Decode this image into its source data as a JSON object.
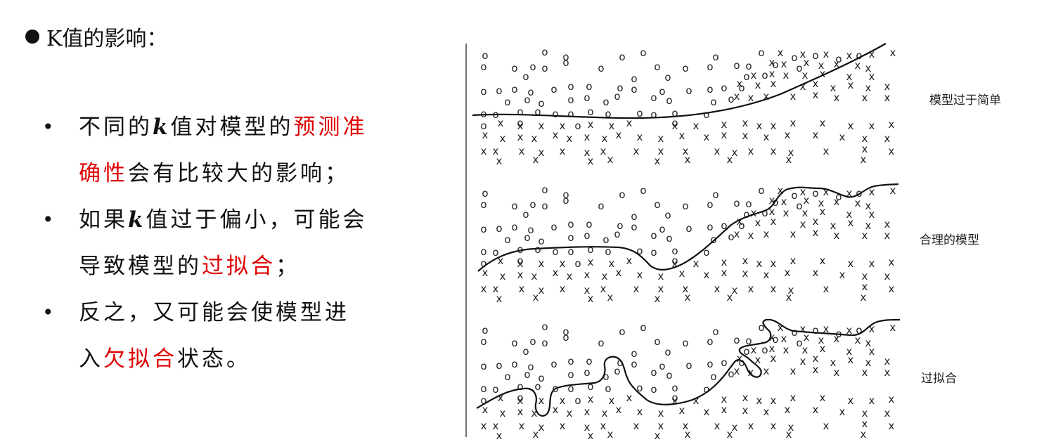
{
  "heading": "K值的影响：",
  "bullets": [
    {
      "mark": "•",
      "line1": {
        "a": "不同的",
        "k": "k",
        "b": "值对模型的",
        "red": "预测准"
      },
      "line2": {
        "red": "确性",
        "b": "会有比较大的影响；"
      }
    },
    {
      "mark": "•",
      "line1": {
        "a": "如果",
        "k": "k",
        "b": "值过于偏小，可能会"
      },
      "line2": {
        "a": "导致模型的",
        "red": "过拟合",
        "b": "；"
      }
    },
    {
      "mark": "•",
      "line1": {
        "a": "反之，又可能会使模型进"
      },
      "line2": {
        "a": "入",
        "red": "欠拟合",
        "b": "状态。"
      }
    }
  ],
  "panels": [
    {
      "label": "模型过于简单",
      "boundary": "underfit"
    },
    {
      "label": "合理的模型",
      "boundary": "reasonable"
    },
    {
      "label": "过拟合",
      "boundary": "overfit"
    }
  ],
  "markers": {
    "class_a": "o",
    "class_b": "x"
  },
  "colors": {
    "highlight": "#e00000",
    "text": "#111111",
    "line": "#111111"
  }
}
